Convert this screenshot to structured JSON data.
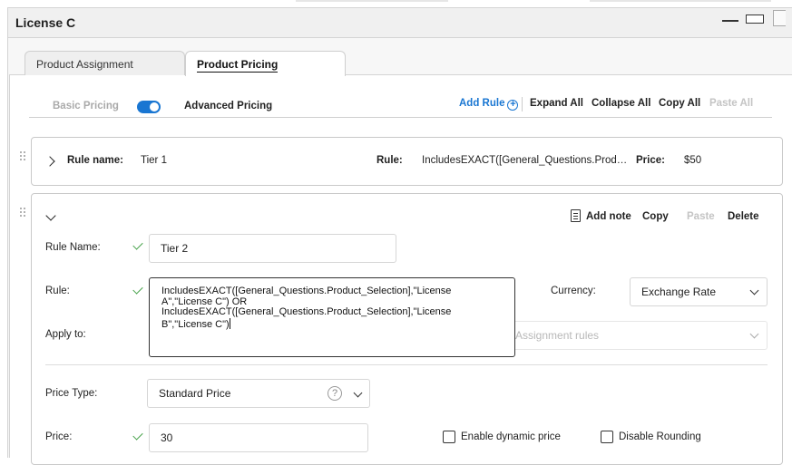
{
  "window": {
    "title": "License C"
  },
  "tabs": [
    {
      "label": "Product Assignment",
      "active": false
    },
    {
      "label": "Product Pricing",
      "active": true
    }
  ],
  "pricing_toolbar": {
    "basic_label": "Basic Pricing",
    "advanced_label": "Advanced Pricing",
    "advanced_enabled": true,
    "add_rule_label": "Add Rule",
    "expand_all_label": "Expand All",
    "collapse_all_label": "Collapse All",
    "copy_all_label": "Copy All",
    "paste_all_label": "Paste All"
  },
  "rule_collapsed": {
    "rule_name_label": "Rule name:",
    "rule_name": "Tier 1",
    "rule_label": "Rule:",
    "rule_value": "IncludesEXACT([General_Questions.Prod…",
    "price_label": "Price:",
    "price_value": "$50"
  },
  "rule_expanded": {
    "actions": {
      "add_note": "Add note",
      "copy": "Copy",
      "paste": "Paste",
      "delete": "Delete"
    },
    "rule_name_label": "Rule Name:",
    "rule_name_value": "Tier 2",
    "rule_label": "Rule:",
    "rule_value": "IncludesEXACT([General_Questions.Product_Selection],\"License A\",\"License C\") OR IncludesEXACT([General_Questions.Product_Selection],\"License B\",\"License C\")",
    "currency_label": "Currency:",
    "currency_value": "Exchange Rate",
    "apply_to_label": "Apply to:",
    "apply_to_placeholder": "Assignment rules",
    "price_type_label": "Price Type:",
    "price_type_value": "Standard Price",
    "price_type_help": "?",
    "price_label": "Price:",
    "price_value": "30",
    "enable_dynamic_label": "Enable dynamic price",
    "enable_dynamic_checked": false,
    "disable_rounding_label": "Disable Rounding",
    "disable_rounding_checked": false
  },
  "colors": {
    "accent": "#1976d2",
    "valid_check": "#43a047",
    "disabled_text": "#c4c4c4"
  },
  "icons": [
    "drag-handle-icon",
    "chevron-right-icon",
    "chevron-down-icon",
    "add-circle-icon",
    "note-icon",
    "check-icon",
    "help-icon",
    "dropdown-chevron-icon",
    "minimize-icon",
    "maximize-icon"
  ]
}
